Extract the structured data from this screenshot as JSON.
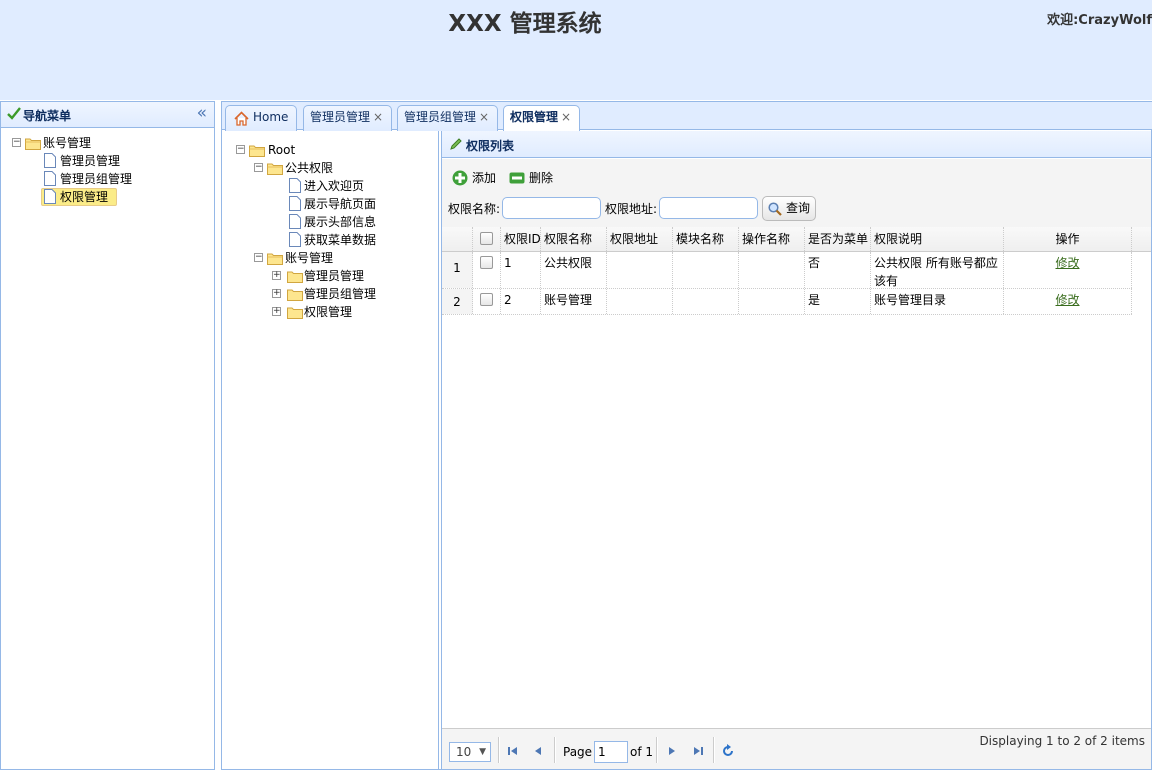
{
  "header": {
    "title": "XXX 管理系统",
    "welcome": "欢迎:CrazyWolf"
  },
  "nav": {
    "title": "导航菜单",
    "root": "账号管理",
    "items": [
      "管理员管理",
      "管理员组管理",
      "权限管理"
    ],
    "selected": "权限管理"
  },
  "tabs": [
    "Home",
    "管理员管理",
    "管理员组管理",
    "权限管理"
  ],
  "tree": {
    "root": "Root",
    "nodes": [
      {
        "label": "公共权限",
        "children": [
          "进入欢迎页",
          "展示导航页面",
          "展示头部信息",
          "获取菜单数据"
        ]
      },
      {
        "label": "账号管理",
        "children": [
          "管理员管理",
          "管理员组管理",
          "权限管理"
        ]
      }
    ]
  },
  "grid": {
    "title": "权限列表",
    "toolbar": {
      "add": "添加",
      "delete": "删除"
    },
    "search": {
      "name_label": "权限名称:",
      "url_label": "权限地址:",
      "button": "查询"
    },
    "columns": [
      "权限ID",
      "权限名称",
      "权限地址",
      "模块名称",
      "操作名称",
      "是否为菜单",
      "权限说明",
      "操作"
    ],
    "rows": [
      {
        "num": "1",
        "id": "1",
        "name": "公共权限",
        "url": "",
        "module": "",
        "action": "",
        "menu": "否",
        "desc": "公共权限 所有账号都应该有",
        "op": "修改"
      },
      {
        "num": "2",
        "id": "2",
        "name": "账号管理",
        "url": "",
        "module": "",
        "action": "",
        "menu": "是",
        "desc": "账号管理目录",
        "op": "修改"
      }
    ],
    "pager": {
      "page_size": "10",
      "page_label": "Page",
      "page": "1",
      "of": "of 1",
      "display": "Displaying 1 to 2 of 2 items"
    }
  },
  "colors": {
    "header_bg": "#e0ecff",
    "border": "#95b8e7",
    "title": "#0e2d5f"
  }
}
